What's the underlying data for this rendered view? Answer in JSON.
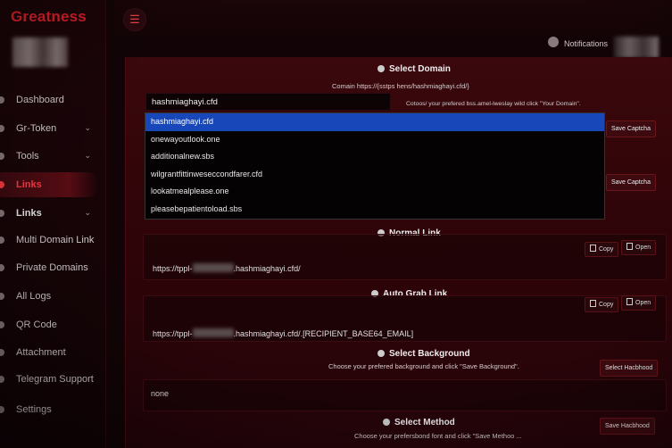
{
  "sidebar": {
    "brand": "Greatness",
    "items": [
      {
        "label": "Dashboard",
        "icon": "home-icon"
      },
      {
        "label": "Gr-Token",
        "icon": "token-icon",
        "chevron": "⌄"
      },
      {
        "label": "Tools",
        "icon": "tools-icon",
        "chevron": "⌄"
      },
      {
        "label": "Links",
        "icon": "link-icon"
      },
      {
        "label": "Links",
        "icon": "link-icon",
        "chevron": "⌄"
      },
      {
        "label": "Multi Domain Link",
        "icon": "globe-icon"
      },
      {
        "label": "Private Domains",
        "icon": "lock-icon"
      },
      {
        "label": "All Logs",
        "icon": "list-icon"
      },
      {
        "label": "QR Code",
        "icon": "qr-icon"
      },
      {
        "label": "Attachment",
        "icon": "paperclip-icon"
      },
      {
        "label": "Telegram Support",
        "icon": "telegram-icon"
      },
      {
        "label": "Settings",
        "icon": "gear-icon"
      }
    ]
  },
  "header": {
    "menu_glyph": "☰",
    "notifications": "Notifications"
  },
  "select_domain": {
    "title": "Select Domain",
    "hint": "Comain https://{sstps hens/hashmiaghayi.cfd/}",
    "input_value": "hashmiaghayi.cfd",
    "side_hint": "Cotoos/ your prefered bss.amel-lweslay wild click \"Your Domain\".",
    "options": [
      "hashmiaghayi.cfd",
      "onewayoutlook.one",
      "additionalnew.sbs",
      "wilgrantfittinweseccondfarer.cfd",
      "lookatmealplease.one",
      "pleasebepatientoload.sbs"
    ],
    "save_captcha_1": "Save Captcha",
    "save_captcha_2": "Save Captcha"
  },
  "normal_link": {
    "title": "Normal Link",
    "prefix": "https://tppl-",
    "suffix": ".hashmiaghayi.cfd/",
    "copy": "Copy",
    "open": "Open"
  },
  "auto_grab": {
    "title": "Auto Grab Link",
    "prefix": "https://tppl-",
    "suffix": ".hashmiaghayi.cfd/.[RECIPIENT_BASE64_EMAIL]",
    "copy": "Copy",
    "open": "Open"
  },
  "select_background": {
    "title": "Select Background",
    "hint": "Choose your prefered background and click \"Save Background\".",
    "button": "Select Hacbhood",
    "value": "none"
  },
  "select_method": {
    "title": "Select Method",
    "hint": "Choose your prefersbond font and click \"Save Methoo ...",
    "button": "Save Hacbhood"
  }
}
